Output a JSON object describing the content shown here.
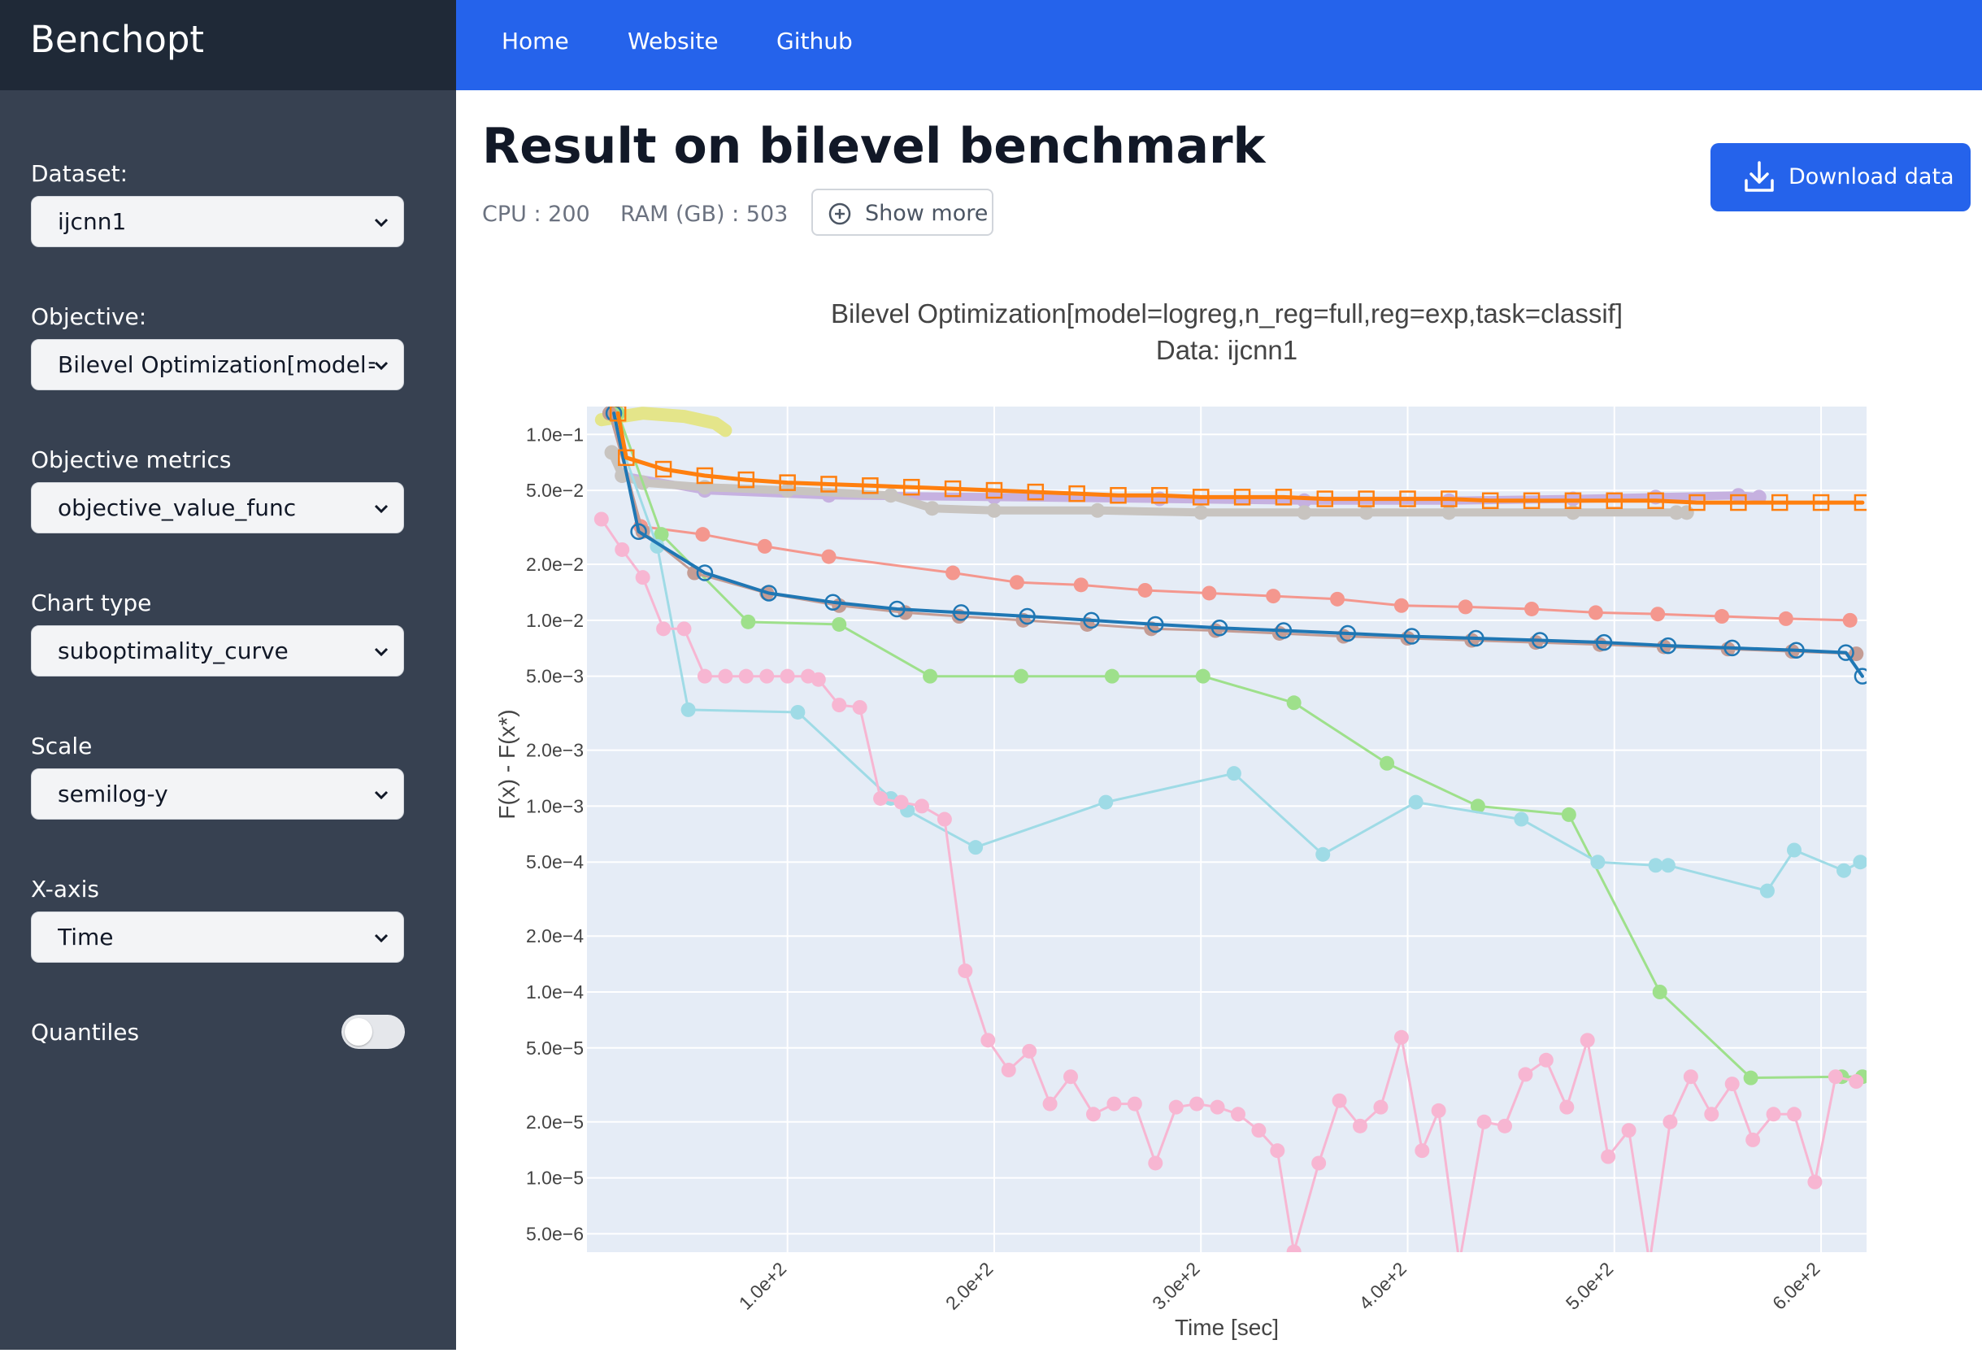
{
  "app": {
    "brand": "Benchopt"
  },
  "nav": {
    "home": "Home",
    "website": "Website",
    "github": "Github"
  },
  "page": {
    "title": "Result on bilevel benchmark",
    "cpu": "CPU : 200",
    "ram": "RAM (GB) : 503",
    "show_more": "Show more",
    "download": "Download data"
  },
  "sidebar": {
    "dataset": {
      "label": "Dataset:",
      "value": "ijcnn1"
    },
    "objective": {
      "label": "Objective:",
      "value": "Bilevel Optimization[model=logreg,n_reg=full,reg=exp,task=classif]"
    },
    "metrics": {
      "label": "Objective metrics",
      "value": "objective_value_func"
    },
    "chart_type": {
      "label": "Chart type",
      "value": "suboptimality_curve"
    },
    "scale": {
      "label": "Scale",
      "value": "semilog-y"
    },
    "xaxis": {
      "label": "X-axis",
      "value": "Time"
    },
    "quantiles": {
      "label": "Quantiles",
      "enabled": false
    }
  },
  "colors": {
    "sidebar": "#374151",
    "brand_bg": "#1f2937",
    "nav": "#2563eb",
    "plot_bg": "#e5ecf6"
  },
  "chart_data": {
    "type": "line",
    "title": "Bilevel Optimization[model=logreg,n_reg=full,reg=exp,task=classif]",
    "subtitle": "Data: ijcnn1",
    "xlabel": "Time [sec]",
    "ylabel": "F(x) - F(x*)",
    "xlim": [
      3,
      622
    ],
    "ylim_log10": [
      -5.4,
      -0.85
    ],
    "y_scale": "log",
    "x_ticks": [
      "1.0e+2",
      "2.0e+2",
      "3.0e+2",
      "4.0e+2",
      "5.0e+2",
      "6.0e+2"
    ],
    "x_tick_values": [
      100,
      200,
      300,
      400,
      500,
      600
    ],
    "y_ticks": [
      "1.0e−1",
      "5.0e−2",
      "2.0e−2",
      "1.0e−2",
      "5.0e−3",
      "2.0e−3",
      "1.0e−3",
      "5.0e−4",
      "2.0e−4",
      "1.0e−4",
      "5.0e−5",
      "2.0e−5",
      "1.0e−5",
      "5.0e−6"
    ],
    "y_tick_values": [
      0.1,
      0.05,
      0.02,
      0.01,
      0.005,
      0.002,
      0.001,
      0.0005,
      0.0002,
      0.0001,
      5e-05,
      2e-05,
      1e-05,
      5e-06
    ],
    "series": [
      {
        "color": "#e4e58a",
        "width": 16,
        "marker": "none",
        "x": [
          10,
          30,
          50,
          65,
          70
        ],
        "y": [
          0.12,
          0.13,
          0.125,
          0.115,
          0.105
        ]
      },
      {
        "color": "#c6b1e0",
        "width": 10,
        "marker": "dot",
        "x": [
          20,
          60,
          120,
          200,
          280,
          350,
          420,
          480,
          520,
          560,
          570
        ],
        "y": [
          0.06,
          0.05,
          0.047,
          0.046,
          0.045,
          0.044,
          0.044,
          0.045,
          0.046,
          0.047,
          0.046
        ]
      },
      {
        "color": "#c8c4c0",
        "width": 10,
        "marker": "dot",
        "x": [
          15,
          20,
          30,
          60,
          100,
          150,
          170,
          200,
          250,
          300,
          350,
          380,
          420,
          480,
          530,
          535
        ],
        "y": [
          0.08,
          0.06,
          0.055,
          0.052,
          0.05,
          0.047,
          0.04,
          0.039,
          0.039,
          0.038,
          0.038,
          0.038,
          0.038,
          0.038,
          0.038,
          0.038
        ]
      },
      {
        "color": "#f4978e",
        "width": 3,
        "marker": "dot",
        "x": [
          15,
          29,
          59,
          89,
          120,
          180,
          211,
          242,
          273,
          304,
          335,
          366,
          397,
          428,
          460,
          491,
          521,
          552,
          583,
          614
        ],
        "y": [
          0.13,
          0.032,
          0.029,
          0.025,
          0.022,
          0.018,
          0.016,
          0.0155,
          0.0145,
          0.014,
          0.0135,
          0.013,
          0.012,
          0.0118,
          0.0115,
          0.011,
          0.0108,
          0.0105,
          0.0102,
          0.01
        ]
      },
      {
        "color": "#9ee08b",
        "width": 3,
        "marker": "dot",
        "x": [
          18,
          39,
          81,
          125,
          169,
          213,
          257,
          301,
          345,
          390,
          434,
          478,
          522,
          566,
          610,
          620
        ],
        "y": [
          0.13,
          0.029,
          0.0098,
          0.0095,
          0.005,
          0.005,
          0.005,
          0.005,
          0.0036,
          0.0017,
          0.001,
          0.0009,
          0.0001,
          3.45e-05,
          3.5e-05,
          3.5e-05
        ]
      },
      {
        "color": "#9fdbe6",
        "width": 3,
        "marker": "dot",
        "x": [
          14,
          37,
          52,
          105,
          150,
          158,
          191,
          254,
          316,
          359,
          404,
          455,
          492,
          520,
          526,
          574,
          587,
          611,
          619
        ],
        "y": [
          0.13,
          0.025,
          0.0033,
          0.0032,
          0.0011,
          0.00095,
          0.0006,
          0.00105,
          0.0015,
          0.00055,
          0.00105,
          0.00085,
          0.0005,
          0.00048,
          0.00048,
          0.00035,
          0.00058,
          0.00045,
          0.0005
        ]
      },
      {
        "color": "#f7b6d2",
        "width": 3,
        "marker": "dot",
        "x": [
          10,
          20,
          30,
          40,
          50,
          60,
          70,
          80,
          90,
          100,
          110,
          115,
          125,
          135,
          145,
          155,
          165,
          176,
          186,
          197,
          207,
          217,
          227,
          237,
          248,
          258,
          268,
          278,
          288,
          298,
          308,
          318,
          328,
          337,
          345,
          357,
          367,
          377,
          387,
          397,
          407,
          415,
          425,
          437,
          447,
          457,
          467,
          477,
          487,
          497,
          507,
          517,
          527,
          537,
          547,
          557,
          567,
          577,
          587,
          597,
          607,
          617
        ],
        "y": [
          0.035,
          0.024,
          0.017,
          0.009,
          0.009,
          0.005,
          0.005,
          0.005,
          0.005,
          0.005,
          0.005,
          0.0048,
          0.0035,
          0.0034,
          0.0011,
          0.00105,
          0.001,
          0.00085,
          0.00013,
          5.5e-05,
          3.8e-05,
          4.8e-05,
          2.5e-05,
          3.5e-05,
          2.2e-05,
          2.5e-05,
          2.5e-05,
          1.2e-05,
          2.4e-05,
          2.5e-05,
          2.4e-05,
          2.2e-05,
          1.8e-05,
          1.4e-05,
          4e-06,
          1.2e-05,
          2.6e-05,
          1.9e-05,
          2.4e-05,
          5.7e-05,
          1.4e-05,
          2.3e-05,
          3.5e-06,
          2e-05,
          1.9e-05,
          3.6e-05,
          4.3e-05,
          2.4e-05,
          5.5e-05,
          1.3e-05,
          1.8e-05,
          3.5e-06,
          2e-05,
          3.5e-05,
          2.2e-05,
          3.2e-05,
          1.6e-05,
          2.2e-05,
          2.2e-05,
          9.5e-06,
          3.5e-05,
          3.3e-05
        ]
      },
      {
        "color": "#c49c94",
        "width": 3,
        "marker": "dot",
        "x": [
          14,
          30,
          55,
          90,
          125,
          157,
          183,
          214,
          245,
          276,
          307,
          338,
          369,
          400,
          431,
          462,
          493,
          524,
          555,
          586,
          617
        ],
        "y": [
          0.13,
          0.03,
          0.018,
          0.014,
          0.012,
          0.011,
          0.0105,
          0.01,
          0.0095,
          0.009,
          0.0088,
          0.0085,
          0.0082,
          0.008,
          0.0078,
          0.0076,
          0.0074,
          0.0072,
          0.007,
          0.0068,
          0.0066
        ]
      },
      {
        "color": "#1f77b4",
        "width": 4,
        "marker": "open-circle",
        "x": [
          16,
          28,
          60,
          91,
          122,
          153,
          184,
          216,
          247,
          278,
          309,
          340,
          371,
          402,
          433,
          464,
          495,
          526,
          557,
          588,
          612,
          620
        ],
        "y": [
          0.13,
          0.03,
          0.018,
          0.014,
          0.0125,
          0.0115,
          0.011,
          0.0105,
          0.01,
          0.0095,
          0.0091,
          0.0088,
          0.0085,
          0.0082,
          0.008,
          0.0078,
          0.0076,
          0.0073,
          0.0071,
          0.0069,
          0.0067,
          0.005
        ]
      },
      {
        "color": "#ff7f0e",
        "width": 5,
        "marker": "open-square",
        "x": [
          18,
          22,
          40,
          60,
          80,
          100,
          120,
          140,
          160,
          180,
          200,
          220,
          240,
          260,
          280,
          300,
          320,
          340,
          360,
          380,
          400,
          420,
          440,
          460,
          480,
          500,
          520,
          540,
          560,
          580,
          600,
          620
        ],
        "y": [
          0.13,
          0.075,
          0.065,
          0.06,
          0.057,
          0.055,
          0.054,
          0.053,
          0.052,
          0.051,
          0.05,
          0.049,
          0.048,
          0.047,
          0.047,
          0.046,
          0.046,
          0.046,
          0.045,
          0.045,
          0.045,
          0.045,
          0.044,
          0.044,
          0.044,
          0.044,
          0.044,
          0.043,
          0.043,
          0.043,
          0.043,
          0.043
        ]
      }
    ]
  }
}
